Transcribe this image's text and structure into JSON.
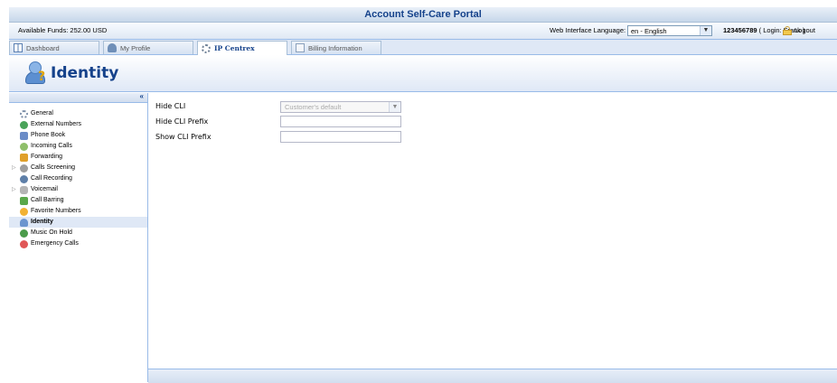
{
  "title": "Account Self-Care Portal",
  "infobar": {
    "funds": "Available Funds: 252.00 USD",
    "language_label": "Web Interface Language:",
    "language_value": "en - English",
    "account_number": "123456789",
    "login_text": "( Login: Frank )",
    "logout_label": "Logout"
  },
  "tabs": [
    {
      "label": "Dashboard",
      "icon": "dashboard-icon"
    },
    {
      "label": "My Profile",
      "icon": "profile-icon"
    },
    {
      "label": "IP Centrex",
      "icon": "gear-icon",
      "active": true
    },
    {
      "label": "Billing Information",
      "icon": "billing-icon"
    }
  ],
  "header": {
    "title": "Identity",
    "icon": "identity-icon"
  },
  "sidebar": {
    "collapse_label": "«",
    "items": [
      {
        "label": "General"
      },
      {
        "label": "External Numbers"
      },
      {
        "label": "Phone Book"
      },
      {
        "label": "Incoming Calls"
      },
      {
        "label": "Forwarding"
      },
      {
        "label": "Calls Screening",
        "expandable": true
      },
      {
        "label": "Call Recording"
      },
      {
        "label": "Voicemail",
        "expandable": true
      },
      {
        "label": "Call Barring"
      },
      {
        "label": "Favorite Numbers"
      },
      {
        "label": "Identity",
        "selected": true
      },
      {
        "label": "Music On Hold"
      },
      {
        "label": "Emergency Calls"
      }
    ]
  },
  "form": {
    "hide_cli": {
      "label": "Hide CLI",
      "value": "Customer's default"
    },
    "hide_cli_prefix": {
      "label": "Hide CLI Prefix",
      "value": ""
    },
    "show_cli_prefix": {
      "label": "Show CLI Prefix",
      "value": ""
    }
  },
  "colors": {
    "accent": "#15428b",
    "border": "#99bbe8",
    "panel": "#dfe8f6"
  }
}
